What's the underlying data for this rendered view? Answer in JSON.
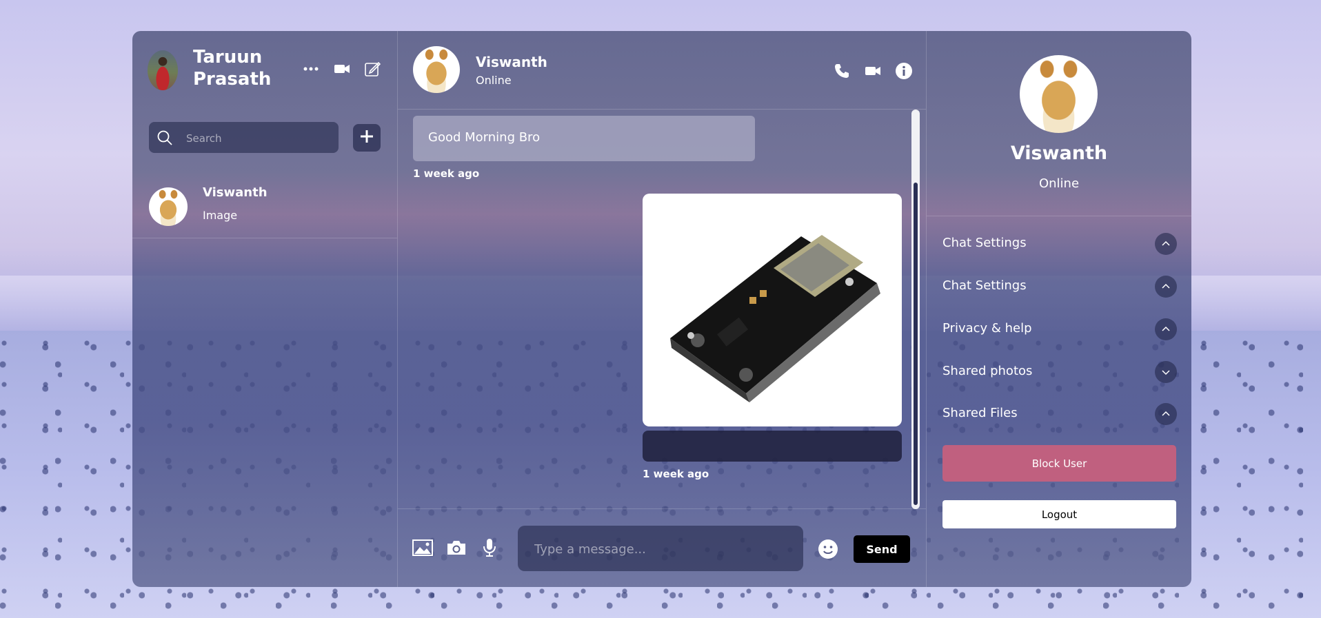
{
  "current_user": {
    "name": "Taruun Prasath"
  },
  "search": {
    "placeholder": "Search"
  },
  "chat_list": [
    {
      "name": "Viswanth",
      "last_message": "Image"
    }
  ],
  "conversation": {
    "contact_name": "Viswanth",
    "contact_status": "Online",
    "messages": [
      {
        "type": "text",
        "direction": "incoming",
        "text": "Good Morning Bro",
        "time": "1 week ago"
      },
      {
        "type": "image",
        "direction": "outgoing",
        "time": "1 week ago"
      }
    ]
  },
  "composer": {
    "placeholder": "Type a message...",
    "send_label": "Send"
  },
  "details": {
    "name": "Viswanth",
    "status": "Online",
    "options": [
      {
        "label": "Chat Settings",
        "state": "expanded"
      },
      {
        "label": "Chat Settings",
        "state": "expanded"
      },
      {
        "label": "Privacy & help",
        "state": "expanded"
      },
      {
        "label": "Shared photos",
        "state": "collapsed"
      },
      {
        "label": "Shared Files",
        "state": "expanded"
      }
    ],
    "block_label": "Block User",
    "logout_label": "Logout"
  },
  "colors": {
    "block_button": "#c0607f",
    "send_button": "#000000"
  },
  "icons": [
    "more-icon",
    "video-icon",
    "edit-icon",
    "search-icon",
    "plus-icon",
    "phone-icon",
    "video-call-icon",
    "info-icon",
    "image-icon",
    "camera-icon",
    "mic-icon",
    "emoji-icon",
    "chevron-up-icon",
    "chevron-down-icon"
  ]
}
